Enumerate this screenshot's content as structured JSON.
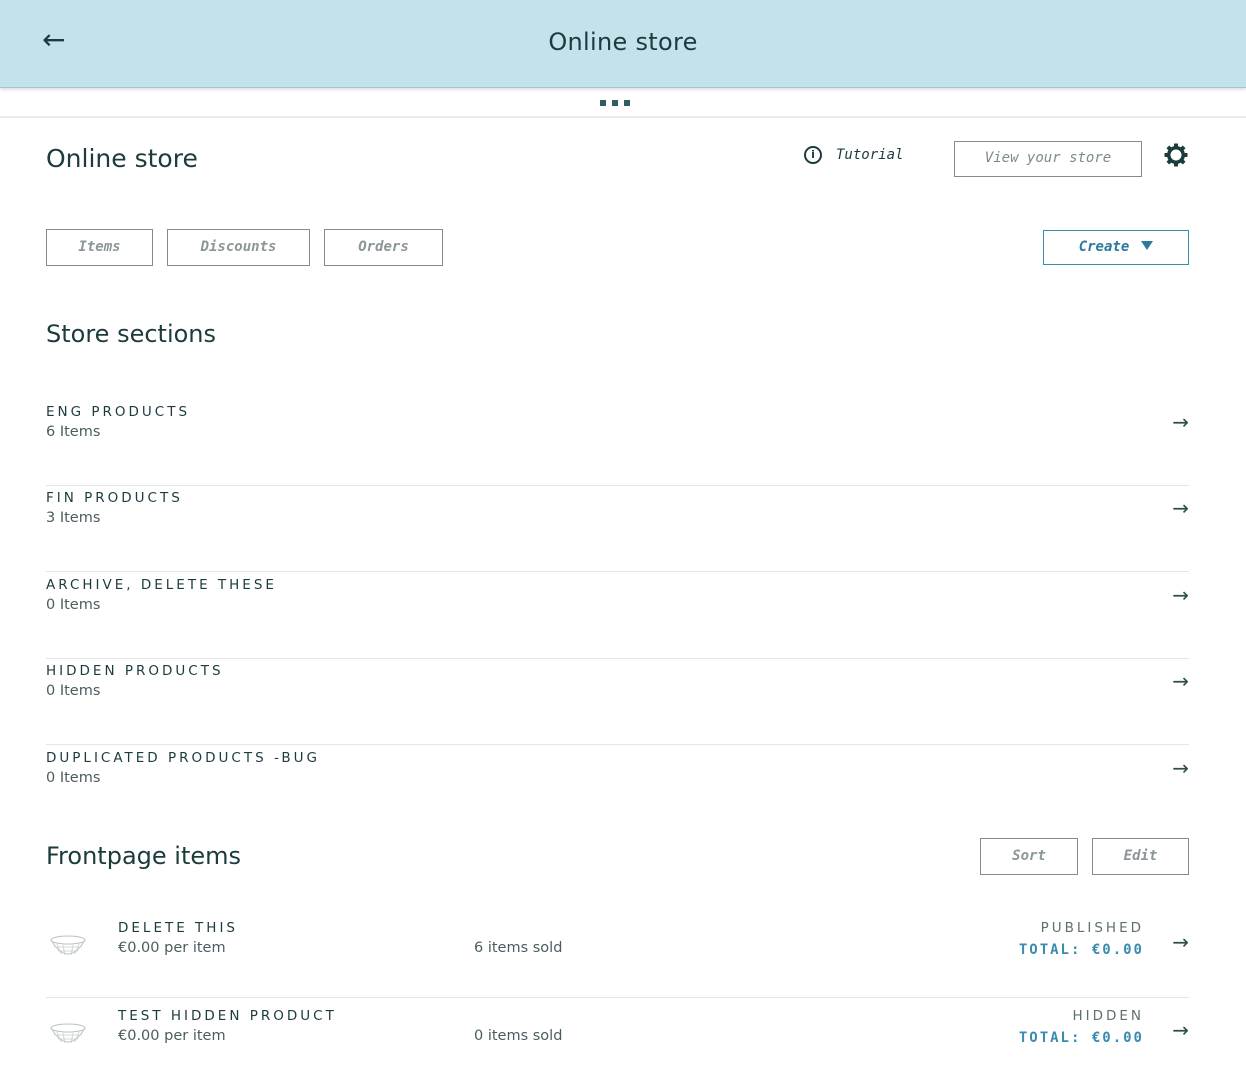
{
  "topbar": {
    "back_icon": "←",
    "title": "Online store"
  },
  "header": {
    "page_title": "Online store",
    "tutorial_label": "Tutorial",
    "view_store_label": "View your store"
  },
  "tabs": {
    "items": "Items",
    "discounts": "Discounts",
    "orders": "Orders",
    "create": "Create"
  },
  "sections": {
    "heading": "Store sections",
    "rows": [
      {
        "name": "ENG PRODUCTS",
        "count": "6 Items"
      },
      {
        "name": "FIN PRODUCTS",
        "count": "3 Items"
      },
      {
        "name": "ARCHIVE, DELETE THESE",
        "count": "0 Items"
      },
      {
        "name": "HIDDEN PRODUCTS",
        "count": "0 Items"
      },
      {
        "name": "DUPLICATED PRODUCTS -BUG",
        "count": "0 Items"
      }
    ]
  },
  "frontpage": {
    "heading": "Frontpage items",
    "sort_label": "Sort",
    "edit_label": "Edit",
    "items": [
      {
        "name": "DELETE THIS",
        "price": "€0.00 per item",
        "sold": "6 items sold",
        "status": "PUBLISHED",
        "total": "TOTAL: €0.00"
      },
      {
        "name": "TEST HIDDEN PRODUCT",
        "price": "€0.00 per item",
        "sold": "0 items sold",
        "status": "HIDDEN",
        "total": "TOTAL: €0.00"
      }
    ]
  },
  "arrow_glyph": "→",
  "colors": {
    "topbar": "#c3e3ec",
    "accent": "#3a8bb0",
    "text": "#1c3b3d"
  }
}
